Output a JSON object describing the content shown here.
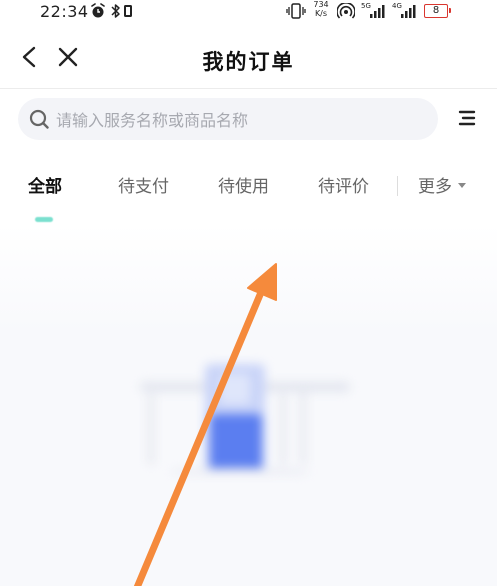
{
  "status_bar": {
    "time": "22:34",
    "net_speed_value": "734",
    "net_speed_unit": "K/s",
    "signal_1_label": "5G",
    "signal_2_label": "4G",
    "battery_level": "8",
    "icons": [
      "alarm-icon",
      "bluetooth-icon",
      "vibrate-icon",
      "hotspot-icon",
      "signal-icon",
      "battery-icon"
    ]
  },
  "header": {
    "title": "我的订单",
    "back_icon": "chevron-left-icon",
    "close_icon": "close-icon"
  },
  "search": {
    "placeholder": "请输入服务名称或商品名称",
    "icon": "search-icon"
  },
  "menu_icon": "list-menu-icon",
  "tabs": {
    "items": [
      {
        "label": "全部",
        "active": true
      },
      {
        "label": "待支付",
        "active": false
      },
      {
        "label": "待使用",
        "active": false
      },
      {
        "label": "待评价",
        "active": false
      }
    ],
    "more_label": "更多"
  },
  "colors": {
    "accent_indicator": "#7be0cf",
    "annotation_arrow": "#f58a3c",
    "battery_low": "#d9362f",
    "illustration_blue": "#5b7ef0"
  }
}
